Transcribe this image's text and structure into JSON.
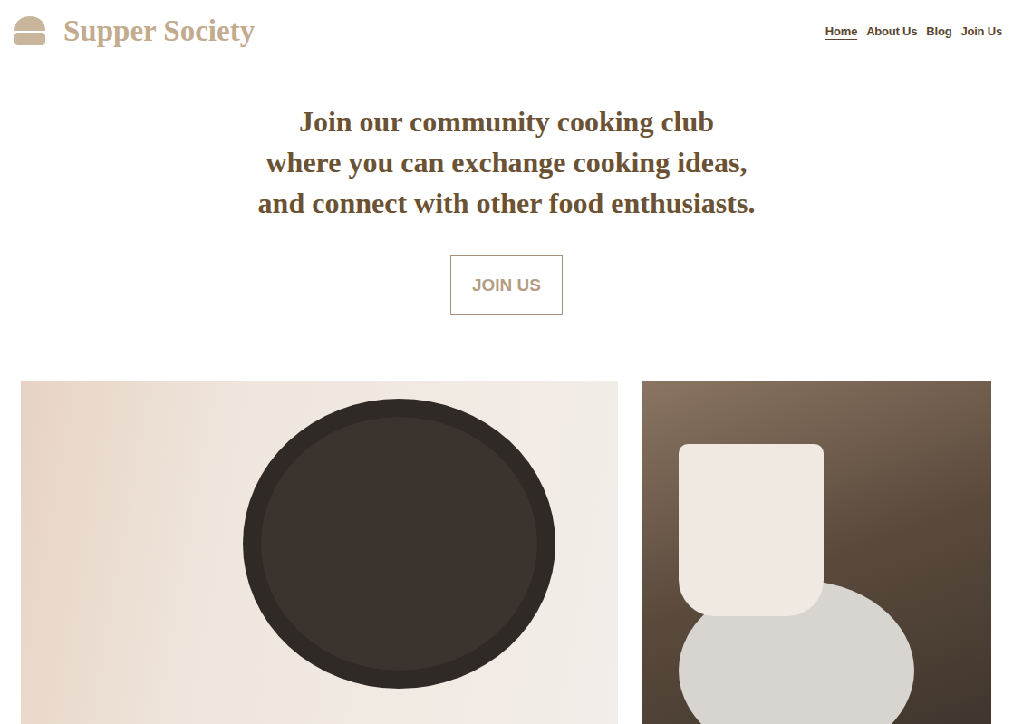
{
  "site": {
    "logo": "Supper Society"
  },
  "nav": [
    {
      "label": "Home",
      "selected": true
    },
    {
      "label": "About Us",
      "selected": false
    },
    {
      "label": "Blog",
      "selected": false
    },
    {
      "label": "Join Us",
      "selected": false
    }
  ],
  "hero": {
    "lines": [
      "Join our community cooking club",
      "where you can exchange cooking ideas,",
      "and connect with other food enthusiasts."
    ],
    "button": "JOIN US"
  }
}
